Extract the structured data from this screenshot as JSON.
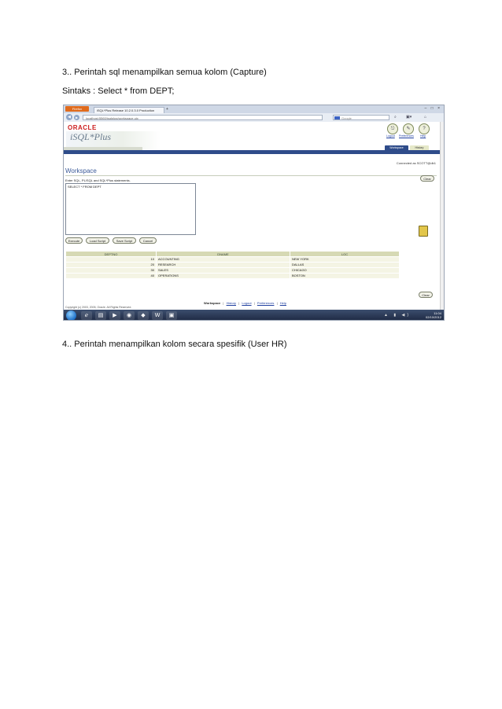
{
  "doc": {
    "line1": "3.. Perintah sql menampilkan semua kolom (Capture)",
    "line2": "Sintaks : Select * from DEPT;",
    "line3": "4.. Perintah menampilkan kolom secara spesifik (User HR)"
  },
  "browser": {
    "menu_button": "Firefox",
    "tab_title": "iSQL*Plus Release 10.2.0.3.0 Production",
    "new_tab": "+",
    "window_controls": "– □ ×",
    "url": "localhost:5560/isqlplus/workspace.uix",
    "search_placeholder": "Google"
  },
  "app": {
    "oracle_logo": "ORACLE",
    "product": "iSQL*Plus",
    "logout": "Logout",
    "preferences": "Preferences",
    "help": "Help",
    "tab_workspace": "Workspace",
    "tab_history": "History",
    "connected": "Connected as SCOTT@db1",
    "workspace_title": "Workspace",
    "enter_label": "Enter SQL, PL/SQL and SQL*Plus statements.",
    "query": "SELECT * FROM DEPT",
    "buttons": {
      "clear": "Clear",
      "execute": "Execute",
      "load": "Load Script",
      "save": "Save Script",
      "cancel": "Cancel"
    },
    "table": {
      "headers": [
        "DEPTNO",
        "DNAME",
        "LOC"
      ],
      "rows": [
        [
          "10",
          "ACCOUNTING",
          "NEW YORK"
        ],
        [
          "20",
          "RESEARCH",
          "DALLAS"
        ],
        [
          "30",
          "SALES",
          "CHICAGO"
        ],
        [
          "40",
          "OPERATIONS",
          "BOSTON"
        ]
      ]
    },
    "bottom_nav": {
      "workspace": "Workspace",
      "history": "History",
      "logout": "Logout",
      "preferences": "Preferences",
      "help": "Help",
      "separator": "|"
    },
    "copyright": "Copyright (c) 2003, 2005, Oracle. All Rights Reserved."
  },
  "taskbar": {
    "time": "11:04",
    "date": "02/10/2012"
  }
}
